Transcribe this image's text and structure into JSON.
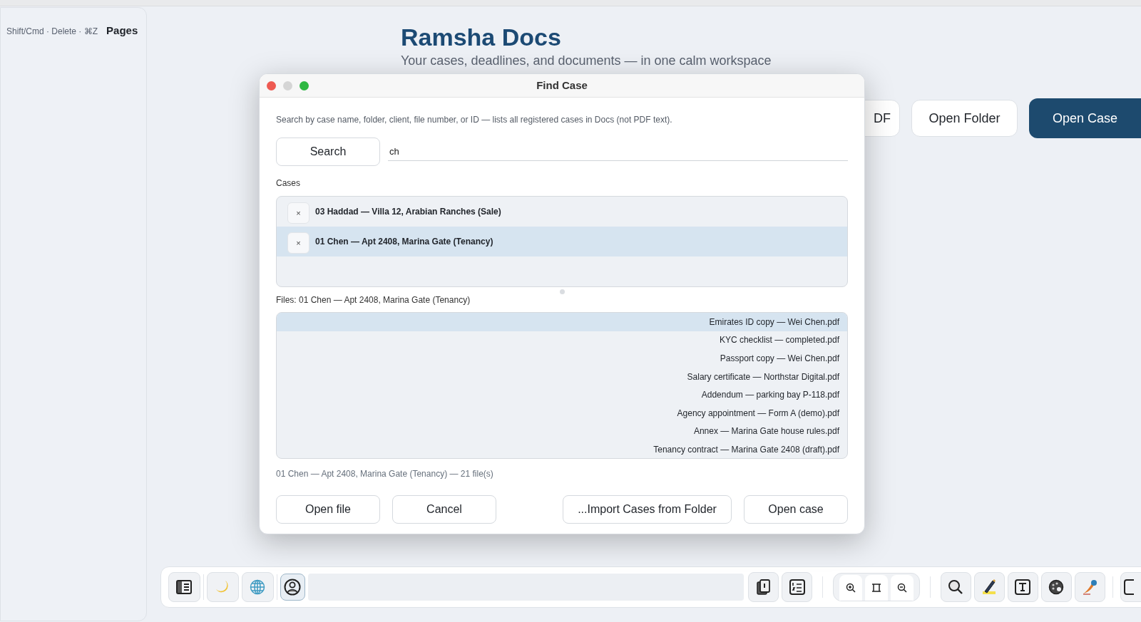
{
  "sidebar": {
    "hint": "Shift/Cmd · Delete · ⌘Z",
    "title": "Pages"
  },
  "header": {
    "title": "Ramsha Docs",
    "subtitle": "Your cases, deadlines, and documents — in one calm workspace"
  },
  "header_buttons": [
    {
      "label": "DF",
      "kind": "secondary"
    },
    {
      "label": "Open Folder",
      "kind": "secondary"
    },
    {
      "label": "Open Case",
      "kind": "primary"
    }
  ],
  "dialog": {
    "title": "Find Case",
    "hint": "Search by case name, folder, client, file number, or ID — lists all registered cases in Docs (not PDF text).",
    "search_button": "Search",
    "query": "ch",
    "cases_label": "Cases",
    "cases": [
      {
        "label": "03 Haddad — Villa 12, Arabian Ranches (Sale)",
        "remove": "×",
        "selected": false
      },
      {
        "label": "01 Chen — Apt 2408, Marina Gate (Tenancy)",
        "remove": "×",
        "selected": true
      }
    ],
    "files_label": "Files: 01 Chen — Apt 2408, Marina Gate (Tenancy)",
    "files": [
      {
        "label": "Emirates ID copy — Wei Chen.pdf",
        "selected": true
      },
      {
        "label": "KYC checklist — completed.pdf",
        "selected": false
      },
      {
        "label": "Passport copy — Wei Chen.pdf",
        "selected": false
      },
      {
        "label": "Salary certificate — Northstar Digital.pdf",
        "selected": false
      },
      {
        "label": "Addendum — parking bay P-118.pdf",
        "selected": false
      },
      {
        "label": "Agency appointment — Form A (demo).pdf",
        "selected": false
      },
      {
        "label": "Annex — Marina Gate house rules.pdf",
        "selected": false
      },
      {
        "label": "Tenancy contract — Marina Gate 2408 (draft).pdf",
        "selected": false
      }
    ],
    "status": "01 Chen — Apt 2408, Marina Gate (Tenancy) — 21 file(s)",
    "buttons": [
      "Open file",
      "Cancel",
      "...Import Cases from Folder",
      "Open case"
    ]
  }
}
